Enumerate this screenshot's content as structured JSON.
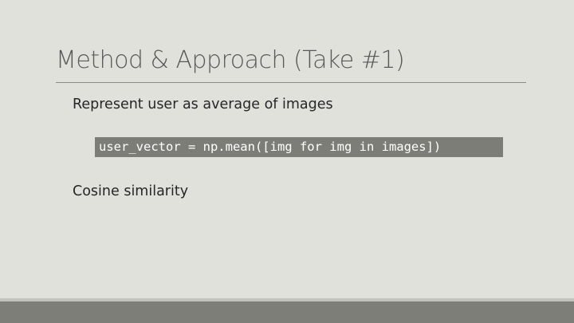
{
  "slide": {
    "title": "Method & Approach (Take #1)",
    "bullets": [
      "Represent user as average of images",
      "Cosine similarity"
    ],
    "code": "user_vector = np.mean([img for img in images])"
  },
  "colors": {
    "background": "#e1e1dc",
    "title_text": "#595959",
    "body_text": "#262626",
    "code_background": "#7d7d78",
    "code_text": "#ffffff",
    "footer": "#7e7e79"
  }
}
